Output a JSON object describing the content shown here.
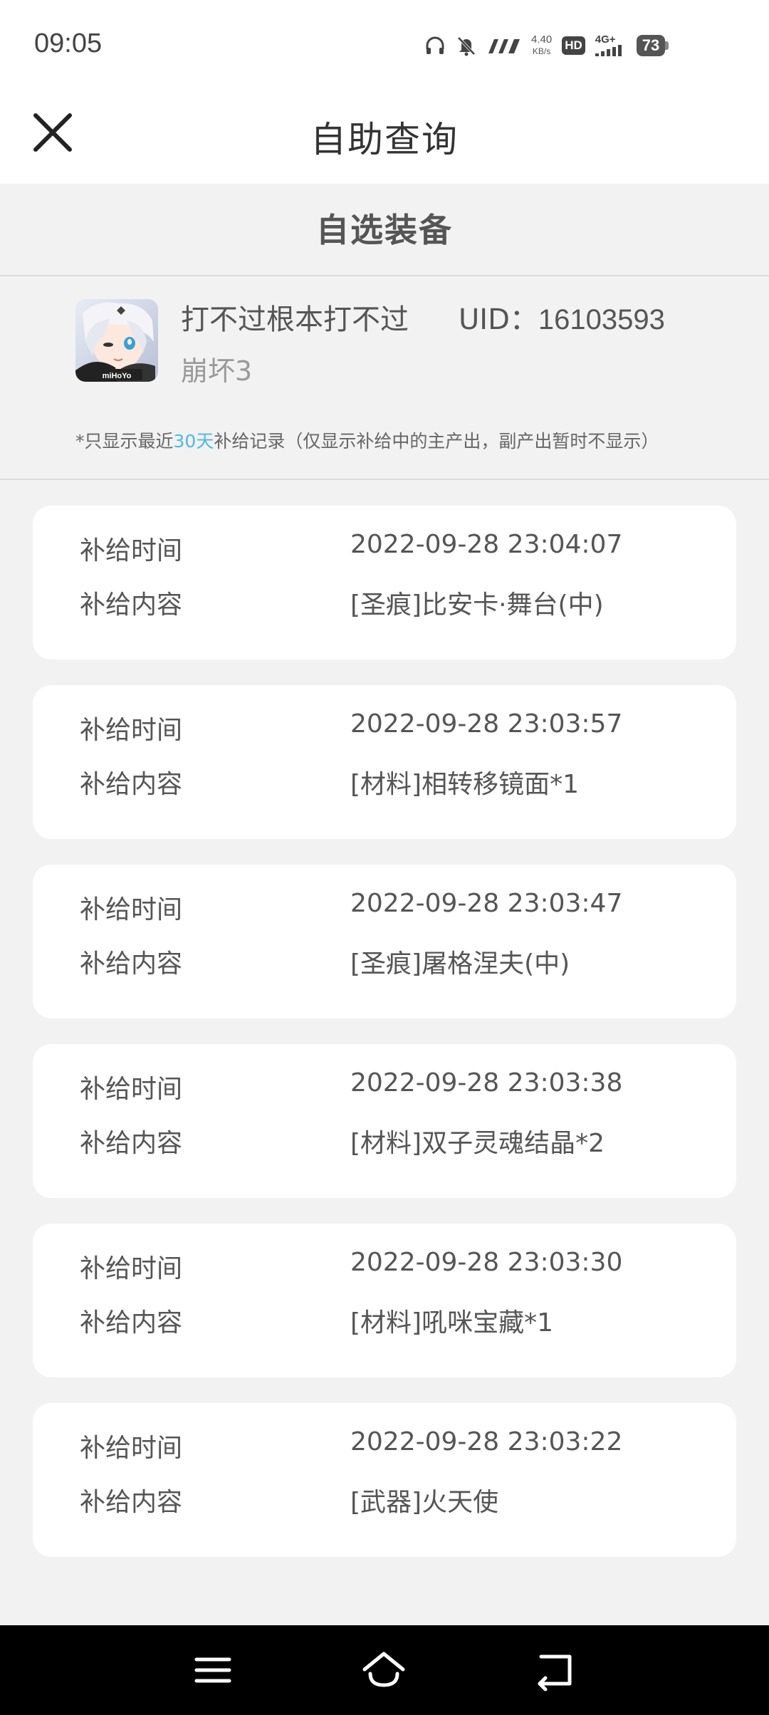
{
  "status_bar": {
    "time": "09:05",
    "net_speed_value": "4.40",
    "net_speed_unit": "KB/s",
    "hd_label": "HD",
    "network_label": "4G+",
    "battery_level": "73",
    "icons": [
      "headphones-icon",
      "mute-icon",
      "signal-icon",
      "hd-icon",
      "cellular-icon",
      "battery-icon"
    ]
  },
  "header": {
    "title": "自助查询",
    "close_icon": "close-icon"
  },
  "section": {
    "title": "自选装备"
  },
  "profile": {
    "username": "打不过根本打不过",
    "uid_label": "UID：",
    "uid_value": "16103593",
    "game_name": "崩坏3",
    "avatar_logo_text": "miHoYo",
    "notice_prefix": "*只显示最近",
    "notice_highlight": "30天",
    "notice_suffix": "补给记录（仅显示补给中的主产出，副产出暂时不显示）",
    "highlight_color": "#4fb8e6"
  },
  "records": [
    {
      "time_label": "补给时间",
      "time_value": "2022-09-28 23:04:07",
      "content_label": "补给内容",
      "content_value": "[圣痕]比安卡·舞台(中)"
    },
    {
      "time_label": "补给时间",
      "time_value": "2022-09-28 23:03:57",
      "content_label": "补给内容",
      "content_value": "[材料]相转移镜面*1"
    },
    {
      "time_label": "补给时间",
      "time_value": "2022-09-28 23:03:47",
      "content_label": "补给内容",
      "content_value": "[圣痕]屠格涅夫(中)"
    },
    {
      "time_label": "补给时间",
      "time_value": "2022-09-28 23:03:38",
      "content_label": "补给内容",
      "content_value": "[材料]双子灵魂结晶*2"
    },
    {
      "time_label": "补给时间",
      "time_value": "2022-09-28 23:03:30",
      "content_label": "补给内容",
      "content_value": "[材料]吼咪宝藏*1"
    },
    {
      "time_label": "补给时间",
      "time_value": "2022-09-28 23:03:22",
      "content_label": "补给内容",
      "content_value": "[武器]火天使"
    }
  ],
  "nav_bar": {
    "icons": [
      "menu-icon",
      "home-icon",
      "back-icon"
    ]
  }
}
